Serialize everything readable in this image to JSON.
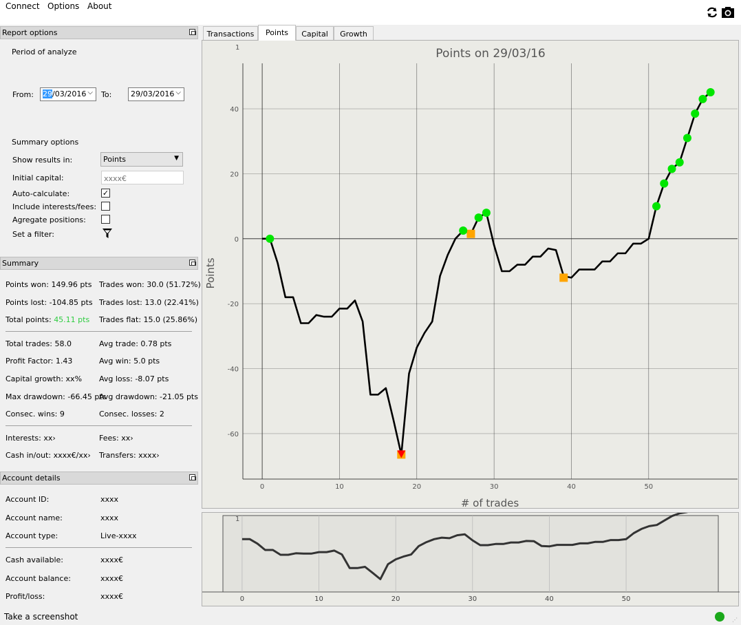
{
  "menu": {
    "connect": "Connect",
    "options": "Options",
    "about": "About"
  },
  "toolbar": {
    "refresh_icon": "refresh-icon",
    "camera_icon": "camera-icon"
  },
  "report_options": {
    "title": "Report options",
    "period_label": "Period of analyze",
    "from_label": "From:",
    "from_day": "29",
    "from_rest": "/03/2016",
    "to_label": "To:",
    "to_value": "29/03/2016",
    "summary_options_label": "Summary options",
    "show_results_label": "Show results in:",
    "show_results_value": "Points",
    "initial_capital_label": "Initial capital:",
    "initial_capital_placeholder": "xxxx€",
    "auto_calculate_label": "Auto-calculate:",
    "auto_calculate_checked": true,
    "include_interests_label": "Include interests/fees:",
    "include_interests_checked": false,
    "agregate_label": "Agregate positions:",
    "agregate_checked": false,
    "filter_label": "Set a filter:"
  },
  "summary": {
    "title": "Summary",
    "points_won": "Points won: 149.96 pts",
    "trades_won": "Trades won: 30.0 (51.72%)",
    "points_lost": "Points lost: -104.85 pts",
    "trades_lost": "Trades lost: 13.0 (22.41%)",
    "total_points_label": "Total points:",
    "total_points_value": "45.11 pts",
    "total_points_color": "#2ecc40",
    "trades_flat": "Trades flat: 15.0 (25.86%)",
    "total_trades": "Total trades: 58.0",
    "avg_trade": "Avg trade: 0.78 pts",
    "profit_factor": "Profit Factor: 1.43",
    "avg_win": "Avg win: 5.0 pts",
    "capital_growth": "Capital growth: xx%",
    "avg_loss": "Avg loss: -8.07 pts",
    "max_drawdown": "Max drawdown: -66.45 pts",
    "avg_drawdown": "Avg drawdown: -21.05 pts",
    "consec_wins": "Consec. wins: 9",
    "consec_losses": "Consec. losses: 2",
    "interests": "Interests: xx›",
    "fees": "Fees: xx›",
    "cash_in_out": "Cash in/out: xxxx€/xx›",
    "transfers": "Transfers: xxxx›"
  },
  "account": {
    "title": "Account details",
    "id_label": "Account ID:",
    "id_value": "xxxx",
    "name_label": "Account name:",
    "name_value": "xxxx",
    "type_label": "Account type:",
    "type_value": "Live-xxxx",
    "cash_label": "Cash available:",
    "cash_value": "xxxx€",
    "balance_label": "Account balance:",
    "balance_value": "xxxx€",
    "pl_label": "Profit/loss:",
    "pl_value": "xxxx€"
  },
  "tabs": [
    "Transactions",
    "Points",
    "Capital",
    "Growth"
  ],
  "active_tab": "Points",
  "status": {
    "text": "Take a screenshot",
    "indicator_color": "#1aa81a"
  },
  "chart_data": [
    {
      "type": "line",
      "title": "Points on 29/03/16",
      "xlabel": "# of trades",
      "ylabel": "Points",
      "corner_label": "1",
      "xlim": [
        -2.5,
        61.5
      ],
      "ylim": [
        -74,
        54
      ],
      "xticks": [
        0,
        10,
        20,
        30,
        40,
        50
      ],
      "yticks": [
        -60,
        -40,
        -20,
        0,
        20,
        40
      ],
      "grid": true,
      "line_color": "#000000",
      "x": [
        0,
        1,
        2,
        3,
        4,
        5,
        6,
        7,
        8,
        9,
        10,
        11,
        12,
        13,
        14,
        15,
        16,
        17,
        18,
        19,
        20,
        21,
        22,
        23,
        24,
        25,
        26,
        27,
        28,
        29,
        30,
        31,
        32,
        33,
        34,
        35,
        36,
        37,
        38,
        39,
        40,
        41,
        42,
        43,
        44,
        45,
        46,
        47,
        48,
        49,
        50,
        51,
        52,
        53,
        54,
        55,
        56,
        57,
        58
      ],
      "y": [
        0,
        0,
        -7.5,
        -18,
        -18,
        -26,
        -26,
        -23.5,
        -24,
        -24,
        -21.5,
        -21.5,
        -19,
        -25.5,
        -48,
        -48,
        -46,
        -56,
        -66.45,
        -41.5,
        -33.5,
        -29,
        -25.5,
        -11.5,
        -5,
        0,
        2.5,
        1.5,
        6.5,
        8,
        -2,
        -10,
        -10,
        -8,
        -8,
        -5.5,
        -5.5,
        -3,
        -3.5,
        -11.5,
        -12,
        -9.5,
        -9.5,
        -9.5,
        -7,
        -7,
        -4.5,
        -4.5,
        -1.5,
        -1.5,
        0,
        10,
        17,
        21.5,
        23.5,
        31,
        38.5,
        43,
        45.11
      ],
      "win_markers": {
        "color": "#00e600",
        "x": [
          1,
          26,
          28,
          29,
          51,
          52,
          53,
          54,
          55,
          56,
          57,
          58
        ],
        "y": [
          0,
          2.5,
          6.5,
          8,
          10,
          17,
          21.5,
          23.5,
          31,
          38.5,
          43,
          45.11
        ]
      },
      "flat_markers": {
        "color": "#ffa500",
        "x": [
          18,
          27,
          39
        ],
        "y": [
          -66.45,
          1.5,
          -12
        ]
      },
      "drawdown_marker": {
        "color": "#ff0000",
        "x": 18,
        "y": -66.45
      }
    },
    {
      "type": "line",
      "title": "",
      "corner_label": "1",
      "xlim": [
        -2.5,
        62
      ],
      "xticks": [
        0,
        10,
        20,
        30,
        40,
        50
      ],
      "line_color": "#333333",
      "series_ref": "same as Points chart"
    }
  ]
}
